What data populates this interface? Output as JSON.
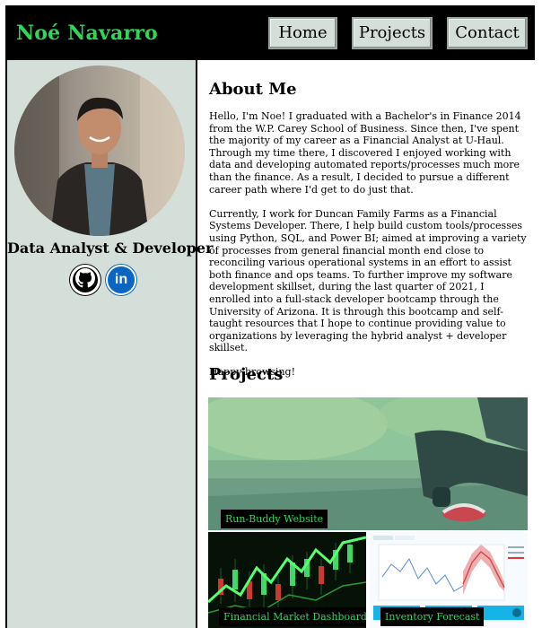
{
  "header": {
    "brand": "Noé Navarro",
    "nav": {
      "home": "Home",
      "projects": "Projects",
      "contact": "Contact"
    }
  },
  "sidebar": {
    "role": "Data Analyst & Developer",
    "socials": {
      "github_icon": "github-icon",
      "linkedin_text": "in"
    }
  },
  "about": {
    "title": "About Me",
    "paragraphs": [
      "Hello, I'm Noe! I graduated with a Bachelor's in Finance 2014 from the W.P. Carey School of Business. Since then, I've spent the majority of my career as a Financial Analyst at U-Haul. Through my time there, I discovered I enjoyed working with data and developing automated reports/processes much more than the finance. As a result, I decided to pursue a different career path where I'd get to do just that.",
      "Currently, I work for Duncan Family Farms as a Financial Systems Developer. There, I help build custom tools/processes using Python, SQL, and Power BI; aimed at improving a variety of processes from general financial month end close to reconciling various operational systems in an effort to assist both finance and ops teams. To further improve my software development skillset, during the last quarter of 2021, I enrolled into a full-stack developer bootcamp through the University of Arizona. It is through this bootcamp and self-taught resources that I hope to continue providing value to organizations by leveraging the hybrid analyst + developer skillset.",
      "Happy browsing!"
    ]
  },
  "projects": {
    "title": "Projects",
    "items": [
      {
        "label": "Run-Buddy Website"
      },
      {
        "label": "Financial Market Dashboard"
      },
      {
        "label": "Inventory Forecast"
      }
    ]
  },
  "colors": {
    "accent": "#2fd65a",
    "sidebar": "#d3dfd8",
    "header": "#000000"
  }
}
